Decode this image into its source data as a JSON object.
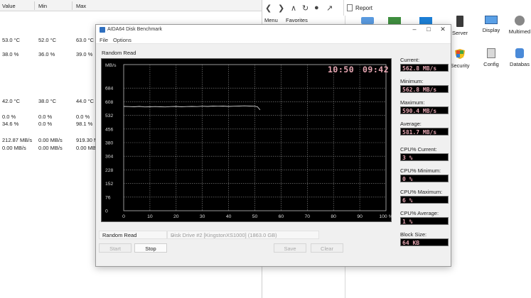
{
  "bg_table": {
    "headers": [
      "Value",
      "Min",
      "Max"
    ],
    "rows": [
      {
        "top": 52,
        "cells": [
          "53.0 °C",
          "52.0 °C",
          "63.0 °C"
        ]
      },
      {
        "top": 72,
        "cells": [
          "38.0 %",
          "36.0 %",
          "39.0 %"
        ]
      },
      {
        "top": 138,
        "cells": [
          "42.0 °C",
          "38.0 °C",
          "44.0 °C"
        ]
      },
      {
        "top": 160,
        "cells": [
          "0.0 %",
          "0.0 %",
          "0.0 %"
        ]
      },
      {
        "top": 170,
        "cells": [
          "34.6 %",
          "0.0 %",
          "98.1 %"
        ]
      },
      {
        "top": 193,
        "cells": [
          "212.87 MB/s",
          "0.00 MB/s",
          "919.30 M"
        ]
      },
      {
        "top": 204,
        "cells": [
          "0.00 MB/s",
          "0.00 MB/s",
          "0.00 MB/s"
        ]
      }
    ]
  },
  "right_panel": {
    "report_label": "Report",
    "menu_label": "Menu",
    "favorites_label": "Favorites",
    "icons": [
      {
        "label": "Server",
        "name": "server-icon"
      },
      {
        "label": "Display",
        "name": "display-icon"
      },
      {
        "label": "Multimed",
        "name": "multimedia-icon"
      },
      {
        "label": "Security",
        "name": "security-icon"
      },
      {
        "label": "Config",
        "name": "config-icon"
      },
      {
        "label": "Databas",
        "name": "database-icon"
      }
    ]
  },
  "window": {
    "title": "AIDA64 Disk Benchmark",
    "menu_file": "File",
    "menu_options": "Options",
    "test_name": "Random Read",
    "clock_left": "10:50",
    "clock_right": "09:42",
    "stats": {
      "current_label": "Current:",
      "current": "562.8 MB/s",
      "minimum_label": "Minimum:",
      "minimum": "562.8 MB/s",
      "maximum_label": "Maximum:",
      "maximum": "590.4 MB/s",
      "average_label": "Average:",
      "average": "581.7 MB/s",
      "cpu_current_label": "CPU% Current:",
      "cpu_current": "3 %",
      "cpu_minimum_label": "CPU% Minimum:",
      "cpu_minimum": "0 %",
      "cpu_maximum_label": "CPU% Maximum:",
      "cpu_maximum": "6 %",
      "cpu_average_label": "CPU% Average:",
      "cpu_average": "1 %",
      "block_size_label": "Block Size:",
      "block_size": "64 KB"
    },
    "controls": {
      "test_select": "Random Read",
      "drive_select": "Disk Drive #2  [KingstonXS1000]  (1863.0 GB)",
      "start_label": "Start",
      "stop_label": "Stop",
      "save_label": "Save",
      "clear_label": "Clear"
    }
  },
  "chart_data": {
    "type": "line",
    "ylabel": "MB/s",
    "y_ticks": [
      0,
      76,
      152,
      228,
      304,
      380,
      456,
      532,
      608,
      684
    ],
    "x_ticks": [
      "0",
      "10",
      "20",
      "30",
      "40",
      "50",
      "60",
      "70",
      "80",
      "90",
      "100 %"
    ],
    "x": [
      0,
      2,
      4,
      6,
      8,
      10,
      12,
      14,
      16,
      18,
      20,
      22,
      24,
      26,
      28,
      30,
      32,
      34,
      36,
      38,
      40,
      42,
      44,
      46,
      48,
      50,
      51,
      52
    ],
    "values": [
      582,
      581,
      580,
      582,
      579,
      580,
      581,
      580,
      579,
      581,
      582,
      580,
      581,
      582,
      581,
      583,
      582,
      584,
      583,
      584,
      582,
      583,
      584,
      585,
      584,
      583,
      580,
      563
    ],
    "xlim": [
      0,
      100
    ],
    "ylim": [
      0,
      760
    ],
    "grid": true,
    "line_color": "#cfcfcf"
  }
}
